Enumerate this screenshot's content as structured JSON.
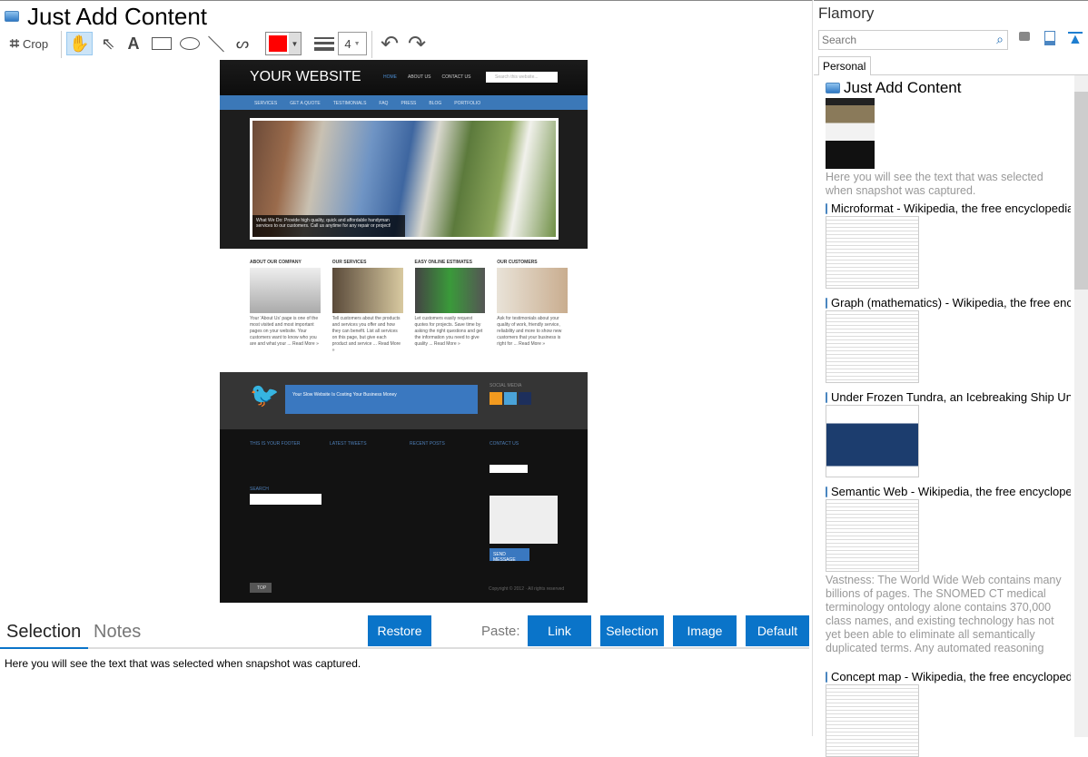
{
  "window": {
    "title": "Just Add Content"
  },
  "toolbar": {
    "crop_label": "Crop",
    "line_width": "4",
    "color": "#ff0000"
  },
  "snapshot": {
    "site_title": "YOUR WEBSITE",
    "top_nav": [
      "HOME",
      "ABOUT US",
      "CONTACT US"
    ],
    "search_placeholder": "Search this website...",
    "menu": [
      "SERVICES",
      "GET A QUOTE",
      "TESTIMONIALS",
      "FAQ",
      "PRESS",
      "BLOG",
      "PORTFOLIO"
    ],
    "hero_caption": "What We Do: Provide high quality, quick and affordable handyman services to our customers. Call us anytime for any repair or project!",
    "sections": [
      {
        "heading": "ABOUT OUR COMPANY",
        "text": "Your 'About Us' page is one of the most visited and most important pages on your website. Your customers want to know who you are and what your ... Read More »"
      },
      {
        "heading": "OUR SERVICES",
        "text": "Tell customers about the products and services you offer and how they can benefit. List all services on this page, but give each product and service ... Read More »"
      },
      {
        "heading": "EASY ONLINE ESTIMATES",
        "text": "Let customers easily request quotes for projects. Save time by asking the right questions and get the information you need to give quality ... Read More »"
      },
      {
        "heading": "OUR CUSTOMERS",
        "text": "Ask for testimonials about your quality of work, friendly service, reliability and more to show new customers that your business is right for ... Read More »"
      }
    ],
    "tweet": "Your Slow Website Is Costing Your Business Money",
    "social_label": "SOCIAL MEDIA",
    "footer_headings": [
      "THIS IS YOUR FOOTER",
      "LATEST TWEETS",
      "RECENT POSTS",
      "CONTACT US"
    ],
    "footer_search_label": "SEARCH",
    "send_label": "SEND MESSAGE",
    "top_label": "TOP",
    "copyright": "Copyright © 2012 · All rights reserved"
  },
  "bottom": {
    "tabs": [
      "Selection",
      "Notes"
    ],
    "restore": "Restore",
    "paste_label": "Paste:",
    "paste_buttons": [
      "Link",
      "Selection",
      "Image",
      "Default"
    ],
    "selection_text": "Here you will see the text that was selected when snapshot was captured."
  },
  "sidebar": {
    "title": "Flamory",
    "search_placeholder": "Search",
    "tab": "Personal",
    "items": [
      {
        "title": "Just Add Content",
        "desc": "Here you will see the text that was selected when snapshot was captured."
      },
      {
        "title": "Microformat - Wikipedia, the free encyclopedia"
      },
      {
        "title": "Graph (mathematics) - Wikipedia, the free encyclopedia"
      },
      {
        "title": "Under Frozen Tundra, an Icebreaking Ship Uncovers"
      },
      {
        "title": "Semantic Web - Wikipedia, the free encyclopedia",
        "desc": "Vastness: The World Wide Web contains many billions of pages. The SNOMED CT medical terminology ontology alone contains 370,000 class names, and existing technology has not yet been able to eliminate all semantically duplicated terms. Any automated reasoning system will have to deal with truly huge inputs."
      },
      {
        "title": "Concept map - Wikipedia, the free encyclopedia"
      }
    ]
  }
}
